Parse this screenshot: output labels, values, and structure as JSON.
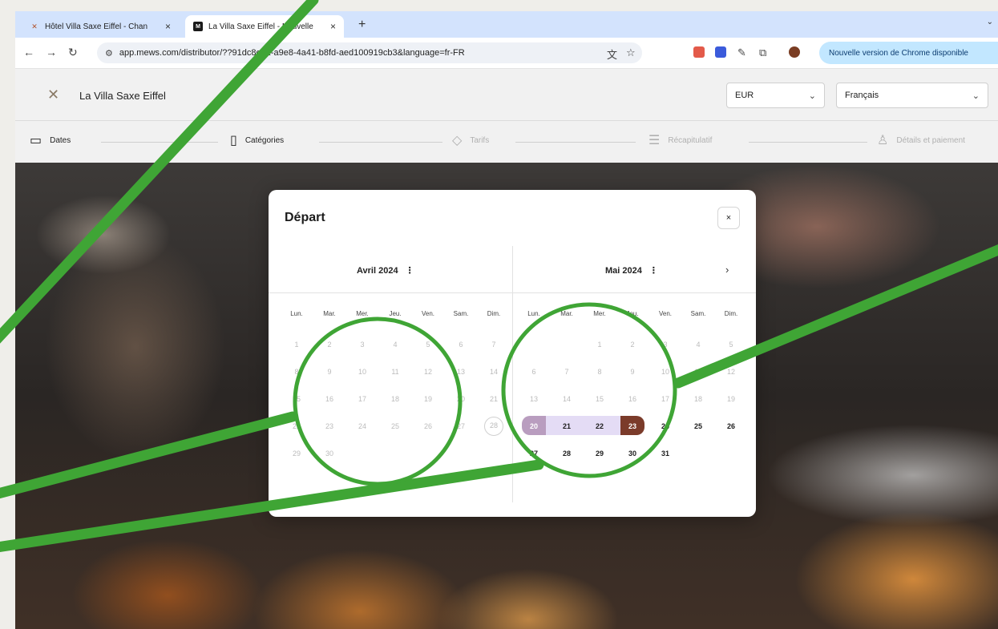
{
  "browser": {
    "tabs": [
      {
        "title": "Hôtel Villa Saxe Eiffel - Chan",
        "favicon": "hotel-logo-icon"
      },
      {
        "title": "La Villa Saxe Eiffel - Nouvelle",
        "favicon": "mews-logo-icon"
      }
    ],
    "new_tab": "+",
    "url": "app.mews.com/distributor/??91dc8e81-a9e8-4a41-b8fd-aed100919cb3&language=fr-FR",
    "update_label": "Nouvelle version de Chrome disponible"
  },
  "header": {
    "hotel_name": "La Villa Saxe Eiffel",
    "currency": "EUR",
    "language": "Français"
  },
  "steps": [
    {
      "label": "Dates",
      "icon": "calendar-icon",
      "active": true
    },
    {
      "label": "Catégories",
      "icon": "door-icon",
      "active": true
    },
    {
      "label": "Tarifs",
      "icon": "tag-icon",
      "active": false
    },
    {
      "label": "Récapitulatif",
      "icon": "list-icon",
      "active": false
    },
    {
      "label": "Détails et paiement",
      "icon": "person-icon",
      "active": false
    }
  ],
  "modal": {
    "title": "Départ",
    "close": "×",
    "next": "›",
    "weekdays": [
      "Lun.",
      "Mar.",
      "Mer.",
      "Jeu.",
      "Ven.",
      "Sam.",
      "Dim."
    ],
    "months": [
      {
        "title": "Avril 2024",
        "menu": "⋮",
        "weeks": [
          [
            "1",
            "2",
            "3",
            "4",
            "5",
            "6",
            "7"
          ],
          [
            "8",
            "9",
            "10",
            "11",
            "12",
            "13",
            "14"
          ],
          [
            "15",
            "16",
            "17",
            "18",
            "19",
            "20",
            "21"
          ],
          [
            "22",
            "23",
            "24",
            "25",
            "26",
            "27",
            "28"
          ],
          [
            "29",
            "30",
            "",
            "",
            "",
            "",
            ""
          ]
        ]
      },
      {
        "title": "Mai 2024",
        "menu": "⋮",
        "weeks": [
          [
            "",
            "",
            "1",
            "2",
            "3",
            "4",
            "5"
          ],
          [
            "6",
            "7",
            "8",
            "9",
            "10",
            "11",
            "12"
          ],
          [
            "13",
            "14",
            "15",
            "16",
            "17",
            "18",
            "19"
          ],
          [
            "20",
            "21",
            "22",
            "23",
            "24",
            "25",
            "26"
          ],
          [
            "27",
            "28",
            "29",
            "30",
            "31",
            "",
            ""
          ]
        ]
      }
    ],
    "selected_range": {
      "start": "20",
      "end": "23"
    },
    "today": "28"
  },
  "colors": {
    "range_fill": "#e4dcf5",
    "range_start": "#b99dbf",
    "range_end": "#7b3b2a",
    "annotation": "#3fa535"
  }
}
